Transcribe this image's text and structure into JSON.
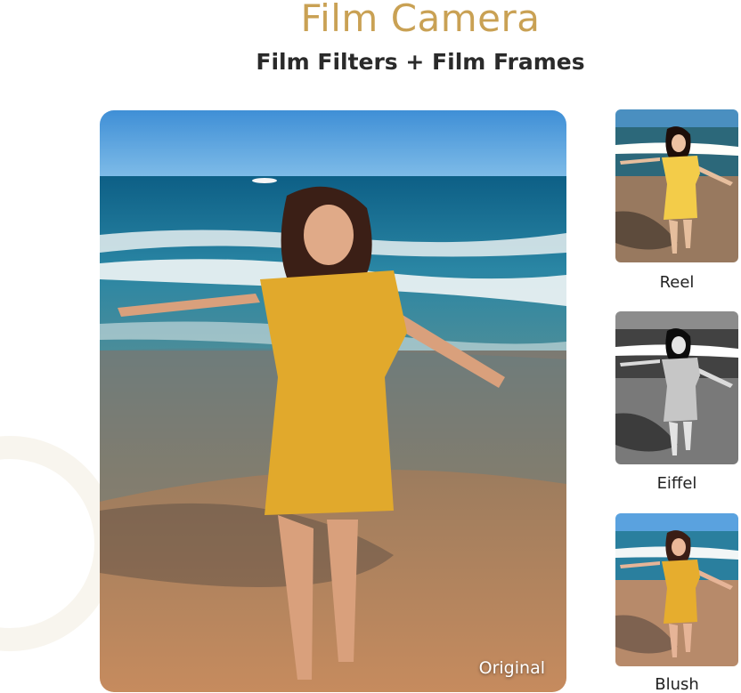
{
  "header": {
    "title": "Film Camera",
    "subtitle": "Film Filters + Film Frames"
  },
  "main_photo": {
    "caption": "Original"
  },
  "filters": [
    {
      "label": "Reel"
    },
    {
      "label": "Eiffel"
    },
    {
      "label": "Blush"
    }
  ],
  "colors": {
    "title": "#c9a154",
    "text": "#2a2a2a"
  }
}
